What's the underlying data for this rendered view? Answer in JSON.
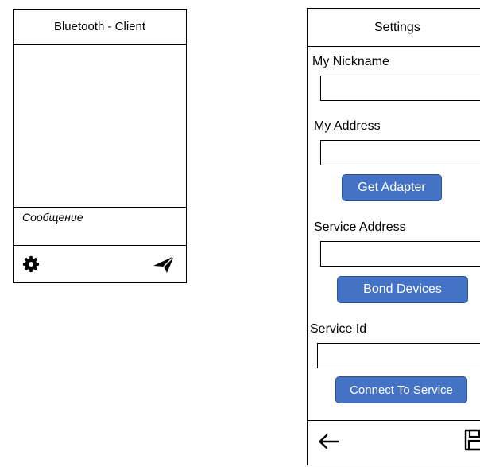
{
  "client": {
    "title": "Bluetooth - Client",
    "message_placeholder": "Сообщение",
    "icons": {
      "settings": "gear-icon",
      "send": "paper-plane-icon"
    }
  },
  "settings": {
    "title": "Settings",
    "nickname_label": "My Nickname",
    "nickname_value": "",
    "address_label": "My Address",
    "address_value": "",
    "get_adapter_label": "Get Adapter",
    "service_address_label": "Service Address",
    "service_address_value": "",
    "bond_devices_label": "Bond Devices",
    "service_id_label": "Service Id",
    "service_id_value": "",
    "connect_label": "Connect To Service",
    "icons": {
      "back": "arrow-left-icon",
      "save": "floppy-disk-icon"
    }
  },
  "colors": {
    "button_fill": "#4472c4",
    "button_border": "#2f528f"
  }
}
